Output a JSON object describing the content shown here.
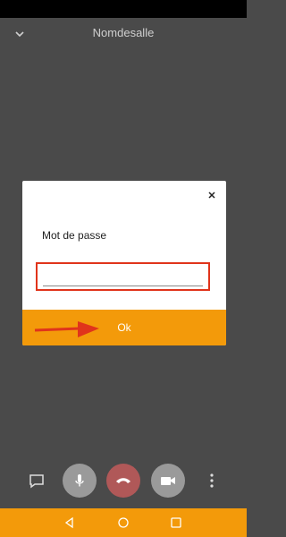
{
  "header": {
    "title": "Nomdesalle",
    "collapse_icon": "chevron-down-icon"
  },
  "dialog": {
    "close_icon": "close-icon",
    "label": "Mot de passe",
    "input_value": "",
    "ok_label": "Ok"
  },
  "controls": {
    "chat_icon": "chat-icon",
    "mic_icon": "microphone-icon",
    "hangup_icon": "phone-hangup-icon",
    "video_icon": "video-camera-icon",
    "more_icon": "more-vertical-icon"
  },
  "colors": {
    "accent": "#f39a0a",
    "highlight": "#e0341b",
    "background": "#4a4a4a",
    "hangup": "#b05858"
  }
}
